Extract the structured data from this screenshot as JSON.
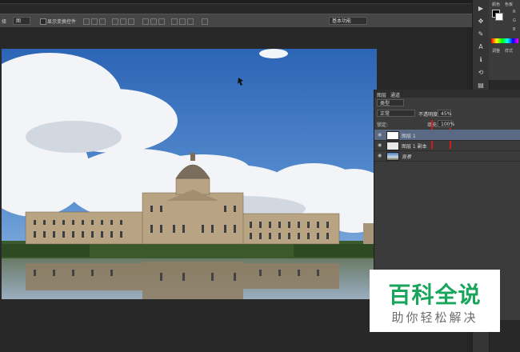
{
  "options_bar": {
    "tool_label": "择",
    "mode_value": "图",
    "checkbox_label": "显示变换控件",
    "workspace": "基本功能"
  },
  "color_panel": {
    "tab1": "颜色",
    "tab2": "色板",
    "channels": [
      "R",
      "G",
      "B"
    ],
    "tab3": "调整",
    "tab4": "样式"
  },
  "layers_panel": {
    "tab_layers": "图层",
    "tab_channels": "通道",
    "filter_kind": "类型",
    "blend_mode": "正常",
    "opacity_label": "不透明度:",
    "opacity_value": "45%",
    "lock_label": "锁定:",
    "fill_label": "填充:",
    "fill_value": "100%",
    "layers": [
      {
        "name": "图层 1",
        "selected": true
      },
      {
        "name": "图层 1 副本",
        "selected": false
      },
      {
        "name": "背景",
        "selected": false
      }
    ]
  },
  "watermark": {
    "title": "百科全说",
    "subtitle": "助你轻松解决",
    "title_color": "#19a55c"
  },
  "colors": {
    "app_bg": "#282828",
    "panel_bg": "#3b3b3b",
    "highlight": "#d21a1a"
  }
}
